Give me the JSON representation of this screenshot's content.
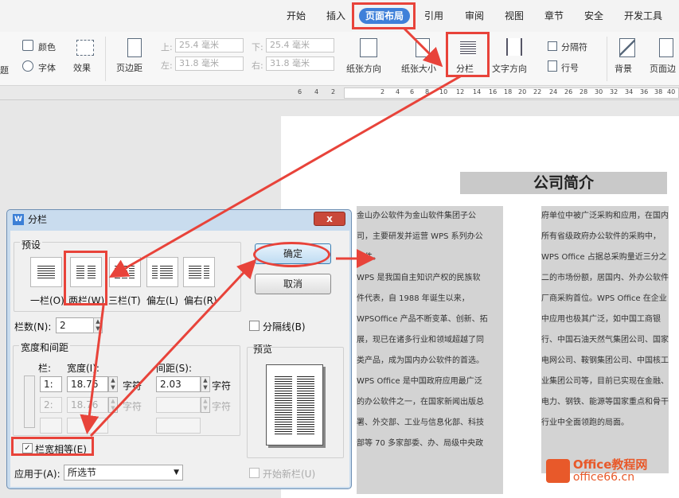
{
  "tabs": [
    "开始",
    "插入",
    "页面布局",
    "引用",
    "审阅",
    "视图",
    "章节",
    "安全",
    "开发工具"
  ],
  "ribbon": {
    "color": "颜色",
    "font": "字体",
    "effect": "效果",
    "margin": "页边距",
    "top_label": "上:",
    "top_val": "25.4 毫米",
    "bottom_label": "下:",
    "bottom_val": "25.4 毫米",
    "left_label": "左:",
    "left_val": "31.8 毫米",
    "right_label": "右:",
    "right_val": "31.8 毫米",
    "orientation": "纸张方向",
    "size": "纸张大小",
    "columns": "分栏",
    "text_dir": "文字方向",
    "separator": "分隔符",
    "line_no": "行号",
    "background": "背景",
    "page_border": "页面边",
    "left_cut": "题"
  },
  "ruler": [
    "6",
    "4",
    "2",
    "2",
    "4",
    "6",
    "8",
    "10",
    "12",
    "14",
    "16",
    "18",
    "20",
    "22",
    "24",
    "26",
    "28",
    "30",
    "32",
    "34",
    "36",
    "38",
    "40"
  ],
  "doc": {
    "title": "公司简介",
    "left": [
      "金山办公软件为金山软件集团子公",
      "司，主要研发并运营 WPS 系列办公",
      "软件。",
      "WPS 是我国自主知识产权的民族软",
      "件代表，自 1988 年诞生以来，",
      "WPSOffice 产品不断变革、创新、拓",
      "展，现已在诸多行业和领域超越了同",
      "类产品，成为国内办公软件的首选。",
      "WPS Office 是中国政府应用最广泛",
      "的办公软件之一，在国家新闻出版总",
      "署、外交部、工业与信息化部、科技",
      "部等 70 多家部委、办、局级中央政"
    ],
    "right": [
      "府单位中被广泛采购和应用，在国内",
      "所有省级政府办公软件的采购中，",
      "WPS Office 占据总采购量近三分之",
      "二的市场份额，居国内、外办公软件",
      "厂商采购首位。WPS Office 在企业",
      "中应用也极其广泛，如中国工商银",
      "行、中国石油天然气集团公司、国家",
      "电网公司、鞍钢集团公司、中国核工",
      "业集团公司等，目前已实现在金融、",
      "电力、钢铁、能源等国家重点和骨干",
      "行业中全面领跑的局面。"
    ]
  },
  "dialog": {
    "title": "分栏",
    "close": "x",
    "preset": "预设",
    "presets": [
      "一栏(O)",
      "两栏(W)",
      "三栏(T)",
      "偏左(L)",
      "偏右(R)"
    ],
    "ok": "确定",
    "cancel": "取消",
    "num_label": "栏数(N):",
    "num_val": "2",
    "divider": "分隔线(B)",
    "ws_group": "宽度和间距",
    "col_h": "栏:",
    "width_h": "宽度(I):",
    "spacing_h": "间距(S):",
    "row1_n": "1:",
    "row1_w": "18.76",
    "unit": "字符",
    "row1_s": "2.03",
    "row2_n": "2:",
    "row2_w": "18.76",
    "preview": "预览",
    "equal": "栏宽相等(E)",
    "equal_checked": "✓",
    "apply_label": "应用于(A):",
    "apply_val": "所选节",
    "new_col": "开始新栏(U)"
  },
  "watermark": {
    "brand": "Office教程网",
    "site": "office66.cn"
  }
}
